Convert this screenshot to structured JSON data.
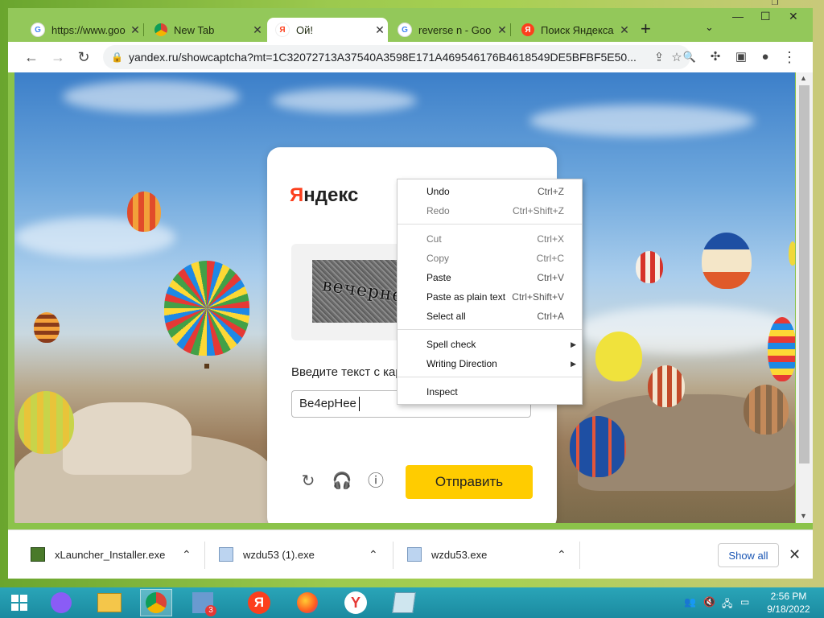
{
  "browser": {
    "tabs": [
      {
        "title": "https://www.goo",
        "favicon": "google-icon",
        "active": false
      },
      {
        "title": "New Tab",
        "favicon": "chrome-icon",
        "active": false
      },
      {
        "title": "Ой!",
        "favicon": "yandex-icon",
        "active": true
      },
      {
        "title": "reverse n - Goo",
        "favicon": "google-icon",
        "active": false
      },
      {
        "title": "Поиск Яндекса",
        "favicon": "yandex-icon",
        "active": false
      }
    ],
    "new_tab_label": "+",
    "url": "yandex.ru/showcaptcha?mt=1C32072713A37540A3598E171A469546176B4618549DE5BFBF5E50..."
  },
  "captcha": {
    "logo_first": "Я",
    "logo_rest": "ндекс",
    "image_word": "вечернее",
    "prompt": "Введите текст с карт",
    "input_value": "Ве4ерНее",
    "submit_label": "Отправить"
  },
  "context_menu": {
    "items": [
      {
        "label": "Undo",
        "shortcut": "Ctrl+Z",
        "enabled": true
      },
      {
        "label": "Redo",
        "shortcut": "Ctrl+Shift+Z",
        "enabled": false
      },
      {
        "label": "Cut",
        "shortcut": "Ctrl+X",
        "enabled": false
      },
      {
        "label": "Copy",
        "shortcut": "Ctrl+C",
        "enabled": false
      },
      {
        "label": "Paste",
        "shortcut": "Ctrl+V",
        "enabled": true
      },
      {
        "label": "Paste as plain text",
        "shortcut": "Ctrl+Shift+V",
        "enabled": true
      },
      {
        "label": "Select all",
        "shortcut": "Ctrl+A",
        "enabled": true
      },
      {
        "label": "Spell check",
        "shortcut": "",
        "enabled": true,
        "submenu": true
      },
      {
        "label": "Writing Direction",
        "shortcut": "",
        "enabled": true,
        "submenu": true
      },
      {
        "label": "Inspect",
        "shortcut": "",
        "enabled": true
      }
    ]
  },
  "downloads": {
    "items": [
      {
        "name": "xLauncher_Installer.exe"
      },
      {
        "name": "wzdu53 (1).exe"
      },
      {
        "name": "wzdu53.exe"
      }
    ],
    "show_all_label": "Show all"
  },
  "taskbar": {
    "time": "2:56 PM",
    "date": "9/18/2022",
    "firefox_badge": "3"
  },
  "colors": {
    "yandex_red": "#fc3f1d",
    "submit_yellow": "#ffcc00",
    "browser_frame_green": "#8bc34a"
  }
}
